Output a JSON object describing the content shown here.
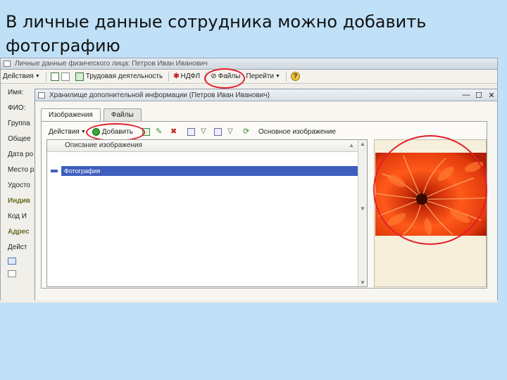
{
  "slide": {
    "title": "В личные данные сотрудника можно добавить фотографию"
  },
  "main_window": {
    "title": "Личные данные физического лица: Петров Иван Иванович",
    "toolbar": {
      "actions_label": "Действия",
      "work_label": "Трудовая деятельность",
      "ndfl_label": "НДФЛ",
      "files_label": "Файлы",
      "goto_label": "Перейти"
    },
    "side_labels": [
      "Имя:",
      "ФИО:",
      "Группа",
      "Общее",
      "Дата ро",
      "Место р",
      "Удосто",
      "Индив",
      "Код И",
      "Адрес",
      "Дейст"
    ]
  },
  "dialog": {
    "title": "Хранилище дополнительной информации (Петров Иван Иванович)",
    "controls": [
      "—",
      "☐",
      "✕"
    ],
    "tabs": [
      {
        "label": "Изображения",
        "active": true
      },
      {
        "label": "Файлы",
        "active": false
      }
    ],
    "toolbar": {
      "actions_label": "Действия",
      "add_label": "Добавить",
      "main_image_label": "Основное изображение"
    },
    "table": {
      "column_header": "Описание изображения",
      "rows": [
        {
          "label": "Фотография",
          "selected": true
        }
      ]
    }
  },
  "colors": {
    "highlight_ring": "#e2202a",
    "selected_row": "#3f5fbf",
    "slide_bg": "#bfe0f7"
  }
}
